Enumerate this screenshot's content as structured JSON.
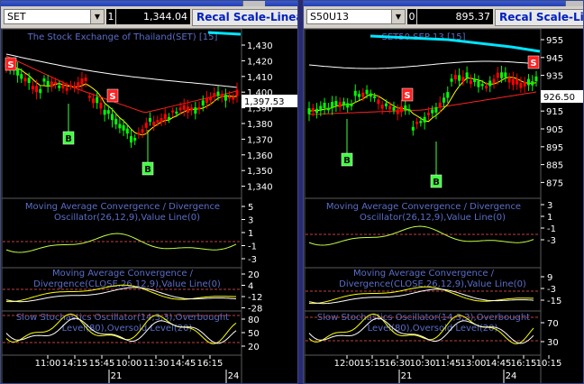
{
  "left": {
    "symbol": "SET",
    "mini": "1",
    "last_price": "1,344.04",
    "recal_label": "Recal Scale-Linear",
    "main_title": "The Stock Exchange of Thailand(SET) [15]",
    "price_tag": "1,397.53",
    "y_ticks": [
      "1,430",
      "1,420",
      "1,410",
      "1,400",
      "1,390",
      "1,380",
      "1,370",
      "1,360",
      "1,350",
      "1,340"
    ],
    "signals": [
      "S",
      "S",
      "B",
      "B"
    ],
    "macd1_title1": "Moving Average Convergence / Divergence",
    "macd1_title2": "Oscillator(26,12,9),Value Line(0)",
    "macd1_ticks": [
      "5",
      "3",
      "1",
      "-1",
      "-3"
    ],
    "macd2_title1": "Moving Average Convergence /",
    "macd2_title2": "Divergence(CLOSE,26,12,9),Value Line(0)",
    "macd2_ticks": [
      "20",
      "4",
      "-12",
      "-28"
    ],
    "sto_title1": "Slow Stochastics Oscillator(14,3,3),Overbought",
    "sto_title2": "Level(80),Oversold Level(20)",
    "sto_ticks": [
      "80",
      "50",
      "20"
    ],
    "time_labels": [
      "11:00",
      "14:15",
      "15:45",
      "10:00",
      "11:30",
      "14:45",
      "16:15"
    ],
    "day_labels": [
      "21",
      "24"
    ]
  },
  "right": {
    "symbol": "S50U13",
    "mini": "0",
    "last_price": "895.37",
    "recal_label": "Recal Scale-Linea",
    "main_title": "SET50 SEP 13 [15]",
    "price_tag": "926.50",
    "y_ticks": [
      "955",
      "945",
      "935",
      "925",
      "915",
      "905",
      "895",
      "885",
      "875"
    ],
    "signals": [
      "S",
      "S",
      "B",
      "B"
    ],
    "macd1_title1": "Moving Average Convergence / Divergence",
    "macd1_title2": "Oscillator(26,12,9),Value Line(0)",
    "macd1_ticks": [
      "3",
      "1",
      "-1",
      "-3"
    ],
    "macd2_title1": "Moving Average Convergence /",
    "macd2_title2": "Divergence(CLOSE,26,12,9),Value Line(0)",
    "macd2_ticks": [
      "9",
      "-3",
      "-15"
    ],
    "sto_title1": "Slow Stochastics Oscillator(14,3,3),Overbought",
    "sto_title2": "Level(80),Oversold Level(20)",
    "sto_ticks": [
      "70",
      "30"
    ],
    "time_labels": [
      "12:00",
      "15:15",
      "16:30",
      "10:30",
      "11:45",
      "13:00",
      "14:45",
      "16:15",
      "10:15"
    ],
    "day_labels": [
      "21",
      "24"
    ]
  },
  "colors": {
    "up_candle": "#00ff00",
    "down_candle": "#ff0000",
    "ma_red": "#ff2020",
    "ma_yellow": "#ffff00",
    "ma_white": "#ffffff",
    "cyan": "#00e5ff",
    "signal_sell": "#ff2020",
    "signal_buy": "#40ff40",
    "indicator_text": "#5a6ec8"
  }
}
